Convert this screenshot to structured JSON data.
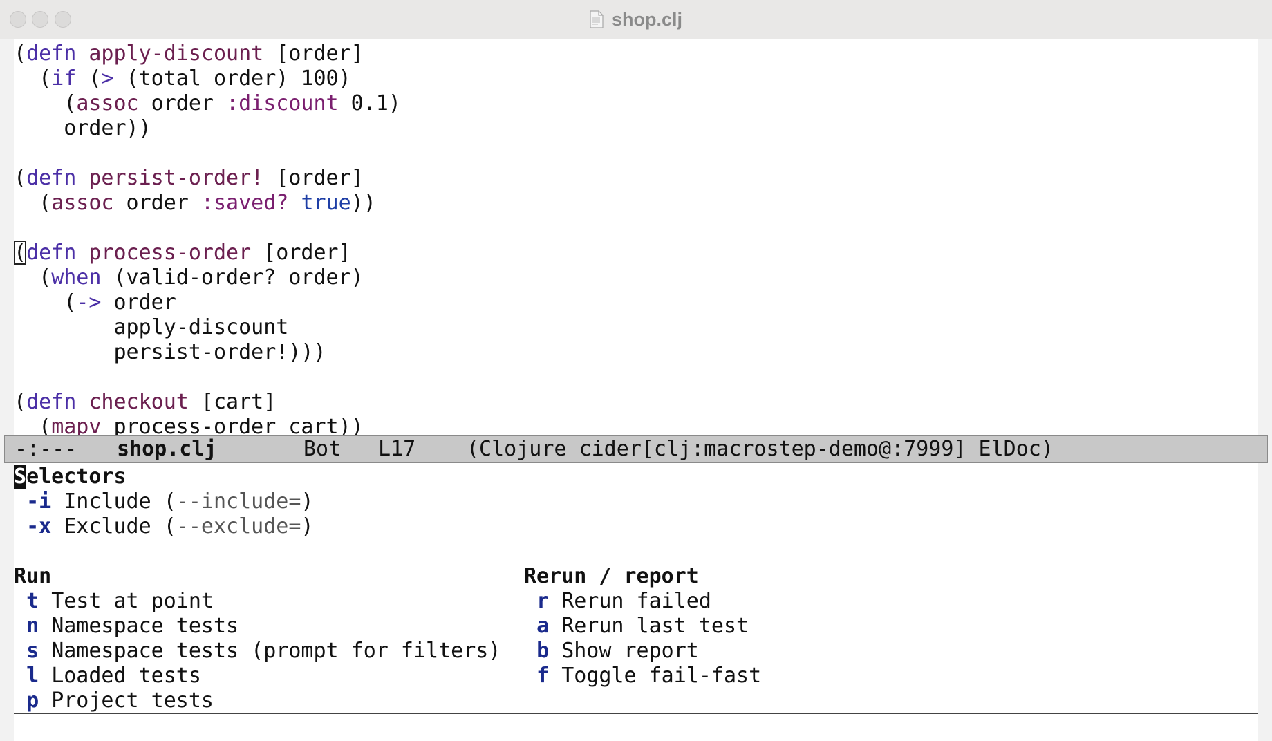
{
  "window": {
    "title": "shop.clj",
    "file_icon": "document-icon"
  },
  "editor": {
    "lines": [
      [
        {
          "t": "("
        },
        {
          "t": "defn",
          "c": "kw"
        },
        {
          "t": " "
        },
        {
          "t": "apply-discount",
          "c": "fn"
        },
        {
          "t": " [order]"
        }
      ],
      [
        {
          "t": "  ("
        },
        {
          "t": "if",
          "c": "kw"
        },
        {
          "t": " ("
        },
        {
          "t": ">",
          "c": "kw"
        },
        {
          "t": " (total order) 100)"
        }
      ],
      [
        {
          "t": "    ("
        },
        {
          "t": "assoc",
          "c": "fn"
        },
        {
          "t": " order "
        },
        {
          "t": ":discount",
          "c": "sym"
        },
        {
          "t": " 0.1)"
        }
      ],
      [
        {
          "t": "    order))"
        }
      ],
      [
        {
          "t": ""
        }
      ],
      [
        {
          "t": "("
        },
        {
          "t": "defn",
          "c": "kw"
        },
        {
          "t": " "
        },
        {
          "t": "persist-order!",
          "c": "fn"
        },
        {
          "t": " [order]"
        }
      ],
      [
        {
          "t": "  ("
        },
        {
          "t": "assoc",
          "c": "fn"
        },
        {
          "t": " order "
        },
        {
          "t": ":saved?",
          "c": "sym"
        },
        {
          "t": " "
        },
        {
          "t": "true",
          "c": "bool"
        },
        {
          "t": "))"
        }
      ],
      [
        {
          "t": ""
        }
      ],
      [
        {
          "t": "(",
          "c": "cursor"
        },
        {
          "t": "defn",
          "c": "kw"
        },
        {
          "t": " "
        },
        {
          "t": "process-order",
          "c": "fn"
        },
        {
          "t": " [order]"
        }
      ],
      [
        {
          "t": "  ("
        },
        {
          "t": "when",
          "c": "kw"
        },
        {
          "t": " (valid-order? order)"
        }
      ],
      [
        {
          "t": "    ("
        },
        {
          "t": "->",
          "c": "kw"
        },
        {
          "t": " order"
        }
      ],
      [
        {
          "t": "        apply-discount"
        }
      ],
      [
        {
          "t": "        persist-order!)))"
        }
      ],
      [
        {
          "t": ""
        }
      ],
      [
        {
          "t": "("
        },
        {
          "t": "defn",
          "c": "kw"
        },
        {
          "t": " "
        },
        {
          "t": "checkout",
          "c": "fn"
        },
        {
          "t": " [cart]"
        }
      ],
      [
        {
          "t": "  ("
        },
        {
          "t": "mapv",
          "c": "fn"
        },
        {
          "t": " process-order cart))"
        }
      ]
    ]
  },
  "modeline": {
    "status": "-:---",
    "buffer": "shop.clj",
    "position": "Bot",
    "line": "L17",
    "modes": "(Clojure cider[clj:macrostep-demo@:7999] ElDoc)"
  },
  "transient": {
    "selectors": {
      "heading_first": "S",
      "heading_rest": "electors",
      "items": [
        {
          "key": "-i",
          "label": "Include",
          "arg": "--include="
        },
        {
          "key": "-x",
          "label": "Exclude",
          "arg": "--exclude="
        }
      ]
    },
    "run": {
      "heading": "Run",
      "items": [
        {
          "key": "t",
          "label": "Test at point"
        },
        {
          "key": "n",
          "label": "Namespace tests"
        },
        {
          "key": "s",
          "label": "Namespace tests (prompt for filters)"
        },
        {
          "key": "l",
          "label": "Loaded tests"
        },
        {
          "key": "p",
          "label": "Project tests"
        }
      ]
    },
    "rerun": {
      "heading": "Rerun / report",
      "items": [
        {
          "key": "r",
          "label": "Rerun failed"
        },
        {
          "key": "a",
          "label": "Rerun last test"
        },
        {
          "key": "b",
          "label": "Show report"
        },
        {
          "key": "f",
          "label": "Toggle fail-fast"
        }
      ]
    }
  }
}
